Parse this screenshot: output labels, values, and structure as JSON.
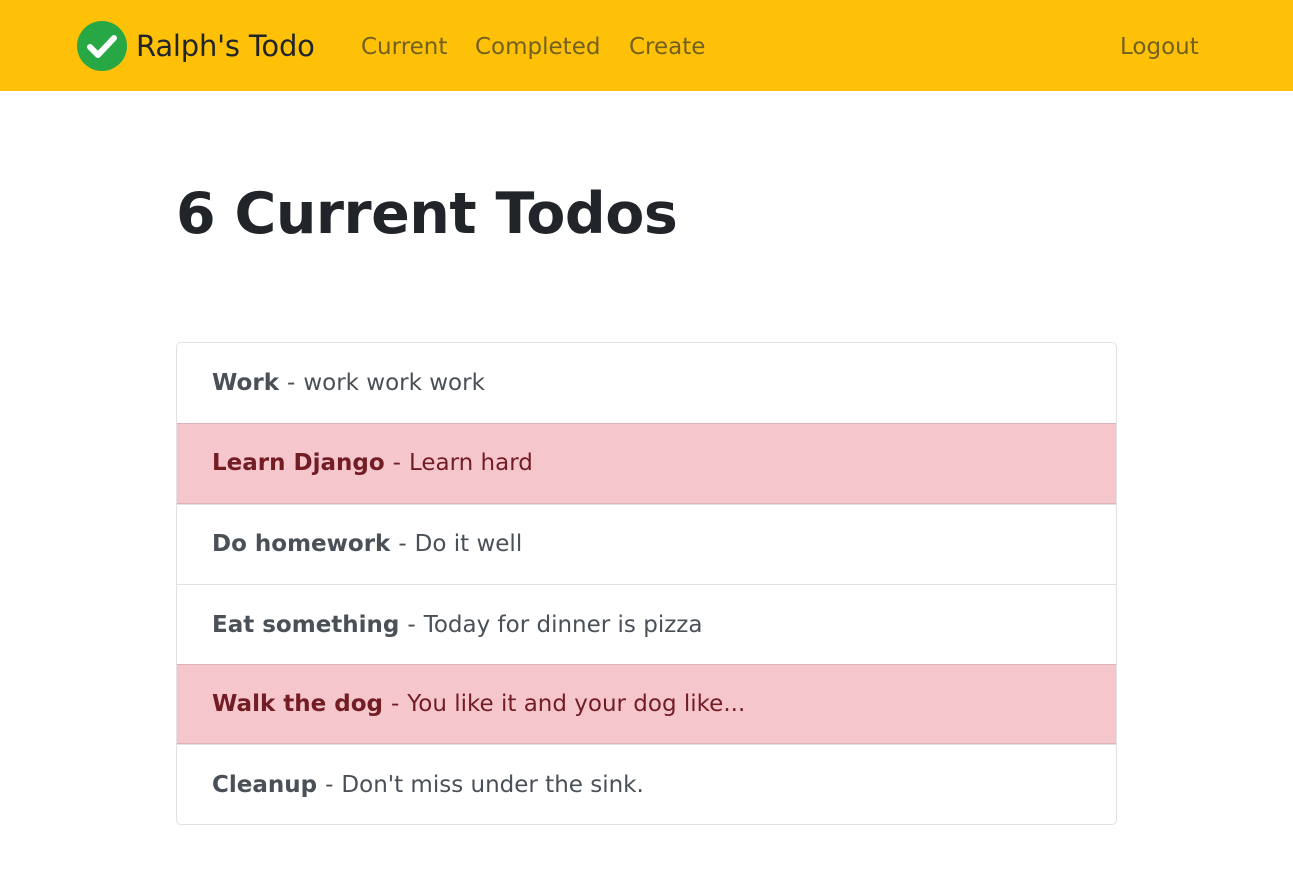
{
  "navbar": {
    "brand_text": "Ralph's Todo",
    "brand_icon": "check-circle-icon",
    "links": {
      "current": "Current",
      "completed": "Completed",
      "create": "Create",
      "logout": "Logout"
    },
    "colors": {
      "background": "#ffc107",
      "link": "#72601f",
      "icon": "#28a745"
    }
  },
  "main": {
    "title": "6 Current Todos",
    "separator": "-",
    "todos": [
      {
        "title": "Work",
        "memo": "work work work",
        "important": false
      },
      {
        "title": "Learn Django",
        "memo": "Learn hard",
        "important": true
      },
      {
        "title": "Do homework",
        "memo": "Do it well",
        "important": false
      },
      {
        "title": "Eat something",
        "memo": "Today for dinner is pizza",
        "important": false
      },
      {
        "title": "Walk the dog",
        "memo": "You like it and your dog like...",
        "important": true
      },
      {
        "title": "Cleanup",
        "memo": "Don't miss under the sink.",
        "important": false
      }
    ],
    "colors": {
      "important_background": "#f5c6cb",
      "important_text": "#721c24"
    }
  }
}
